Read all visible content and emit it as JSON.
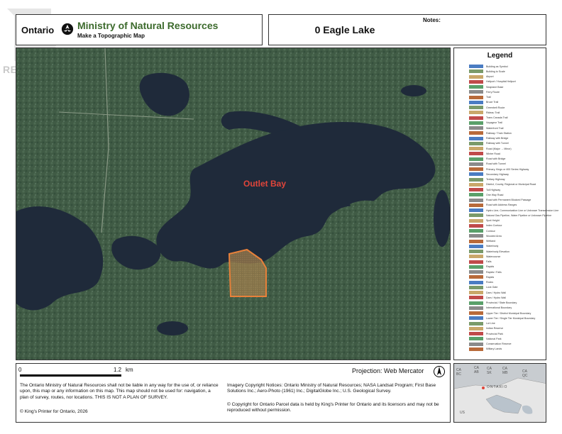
{
  "watermark": {
    "text": "REALTOR®"
  },
  "header": {
    "ontario": "Ontario",
    "ministry": "Ministry of Natural Resources",
    "subtitle": "Make a Topographic Map",
    "notes_label": "Notes:",
    "map_title": "0 Eagle Lake"
  },
  "map": {
    "place_label": "Outlet Bay",
    "colors": {
      "water": "#1f2a3a",
      "land": "#3f5a45",
      "parcel": "#e8813a",
      "label": "#e0453a"
    }
  },
  "legend": {
    "title": "Legend",
    "items": [
      "Building as Symbol",
      "Building to Scale",
      "Airport",
      "Heliport / Hospital Heliport",
      "Seaplane Base",
      "Ferry Route",
      "Trail",
      "Bruce Trail",
      "Greenbelt Route",
      "Rideau Trail",
      "Trans Canada Trail",
      "Voyageur Trail",
      "Waterfront Trail",
      "Railway / Train Station",
      "Railway with Bridge",
      "Railway with Tunnel",
      "Road (Major → Minor)",
      "Winter Road",
      "Road with Bridge",
      "Road with Tunnel",
      "Primary, Kings or 400 Series Highway",
      "Secondary Highway",
      "Tertiary Highway",
      "District, County, Regional or Municipal Road",
      "Toll Highway",
      "One Way Road",
      "Road with Permanent Blocked Passage",
      "Road with Address Ranges",
      "Hydro Line, Communication Line or Unknown Transmission Line",
      "Natural Gas Pipeline, Water Pipeline or Unknown Pipeline",
      "Spot Height",
      "Index Contour",
      "Contour",
      "Wooded Area",
      "Wetland",
      "Waterbody",
      "Waterbody Elevation",
      "Watercourse",
      "Falls",
      "Rapids",
      "Rapids / Falls",
      "Rapids",
      "Rocks",
      "Lock Gate",
      "Dam / Hydro Wall",
      "Dam / Hydro Wall",
      "Provincial / State Boundary",
      "International Boundary",
      "Upper Tier / District Municipal Boundary",
      "Lower Tier / Single Tier Municipal Boundary",
      "Lot Line",
      "Indian Reserve",
      "Provincial Park",
      "National Park",
      "Conservation Reserve",
      "Military Lands"
    ]
  },
  "footer": {
    "scale_zero": "0",
    "scale_distance": "1.2",
    "scale_unit": "km",
    "disclaimer": "The Ontario Ministry of Natural Resources shall not be liable in any way for the use of, or reliance upon, this map or any information on this map.  This map should not be used for: navigation, a plan of survey, routes, nor locations. THIS IS NOT A PLAN OF SURVEY.",
    "copyright": "© King's Printer for Ontario,  2026",
    "projection": "Projection: Web Mercator",
    "imagery": "Imagery Copyright Notices: Ontario Ministry of Natural Resources; NASA Landsat Program; First Base Solutions Inc.; Aero-Photo (1961) Inc.; DigitalGlobe Inc.; U.S. Geological Survey.",
    "parcel_copyright": "© Copyright for Ontario Parcel data is held by King's Printer for Ontario and its licensors and may not be reproduced without permission."
  },
  "inset": {
    "labels": [
      "CA",
      "BC",
      "CA",
      "AB",
      "CA",
      "SK",
      "CA",
      "MB",
      "CA",
      "QC",
      "US",
      "ONTARIO"
    ]
  }
}
